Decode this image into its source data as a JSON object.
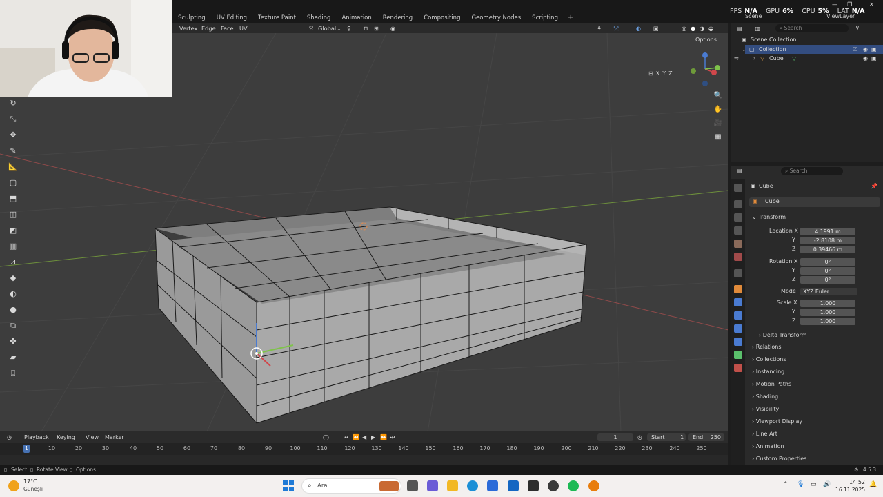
{
  "workspace_tabs": [
    "Sculpting",
    "UV Editing",
    "Texture Paint",
    "Shading",
    "Animation",
    "Rendering",
    "Compositing",
    "Geometry Nodes",
    "Scripting"
  ],
  "add_tab": "+",
  "stats": {
    "fps_label": "FPS",
    "fps": "N/A",
    "gpu_label": "GPU",
    "gpu": "6%",
    "cpu_label": "CPU",
    "cpu": "5%",
    "lat_label": "LAT",
    "lat": "N/A"
  },
  "scene": "Scene",
  "view_layer": "ViewLayer",
  "header": {
    "vertex": "Vertex",
    "edge": "Edge",
    "face": "Face",
    "uv": "UV",
    "orientation": "Global",
    "options": "Options"
  },
  "axis_toggles": [
    "X",
    "Y",
    "Z"
  ],
  "outliner": {
    "search": "Search",
    "scene_collection": "Scene Collection",
    "collection": "Collection",
    "cube": "Cube"
  },
  "properties": {
    "search": "Search",
    "object_name": "Cube",
    "data_name": "Cube",
    "transform": "Transform",
    "location_label": "Location X",
    "loc": {
      "x": "4.1991 m",
      "y": "-2.8108 m",
      "z": "0.39466 m"
    },
    "rotation_label": "Rotation X",
    "rot": {
      "x": "0°",
      "y": "0°",
      "z": "0°"
    },
    "mode_label": "Mode",
    "mode": "XYZ Euler",
    "scale_label": "Scale X",
    "scale": {
      "x": "1.000",
      "y": "1.000",
      "z": "1.000"
    },
    "axis_y": "Y",
    "axis_z": "Z",
    "delta": "Delta Transform",
    "sections": [
      "Relations",
      "Collections",
      "Instancing",
      "Motion Paths",
      "Shading",
      "Visibility",
      "Viewport Display",
      "Line Art",
      "Animation",
      "Custom Properties"
    ]
  },
  "timeline": {
    "playback": "Playback",
    "keying": "Keying",
    "view": "View",
    "marker": "Marker",
    "current": "1",
    "start_label": "Start",
    "start": "1",
    "end_label": "End",
    "end": "250",
    "ticks": [
      "10",
      "20",
      "30",
      "40",
      "50",
      "60",
      "70",
      "80",
      "90",
      "100",
      "110",
      "120",
      "130",
      "140",
      "150",
      "160",
      "170",
      "180",
      "190",
      "200",
      "210",
      "220",
      "230",
      "240",
      "250"
    ]
  },
  "status": {
    "select": "Select",
    "rotate": "Rotate View",
    "options": "Options",
    "version": "4.5.3"
  },
  "taskbar": {
    "temp": "17°C",
    "weather": "Güneşli",
    "search": "Ara",
    "time": "14:52",
    "date": "16.11.2025"
  }
}
